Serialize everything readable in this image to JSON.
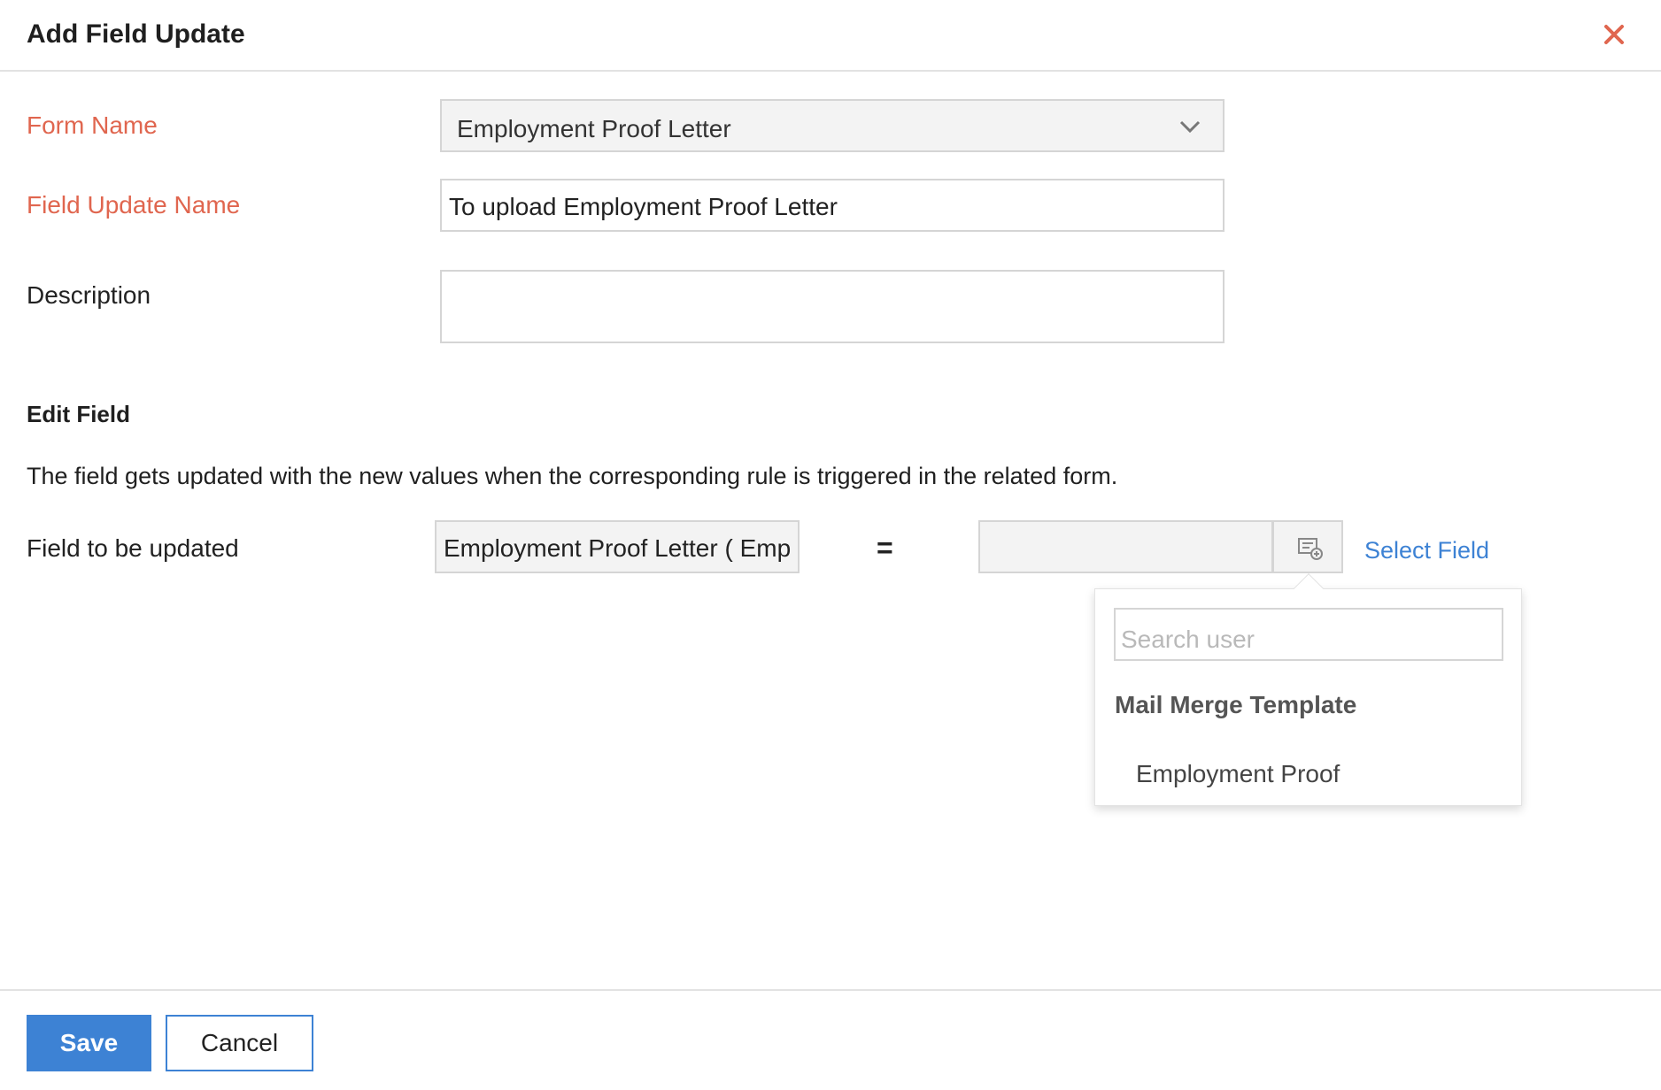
{
  "dialog": {
    "title": "Add Field Update",
    "close_icon": "close-icon",
    "accent_color": "#e0664f"
  },
  "form": {
    "form_name_label": "Form Name",
    "form_name_value": "Employment Proof Letter",
    "field_update_name_label": "Field Update Name",
    "field_update_name_value": "To upload Employment Proof Letter",
    "description_label": "Description",
    "description_value": ""
  },
  "edit_field": {
    "title": "Edit Field",
    "description": "The field gets updated with the new values when the corresponding rule is triggered in the related form.",
    "field_label": "Field to be updated",
    "field_value": "Employment Proof Letter  ( Emp",
    "operator": "=",
    "value": "",
    "select_field_link": "Select Field"
  },
  "dropdown": {
    "search_placeholder": "Search user",
    "group_label": "Mail Merge Template",
    "items": [
      "Employment Proof"
    ]
  },
  "footer": {
    "save_label": "Save",
    "cancel_label": "Cancel",
    "primary_color": "#3d82d4"
  }
}
